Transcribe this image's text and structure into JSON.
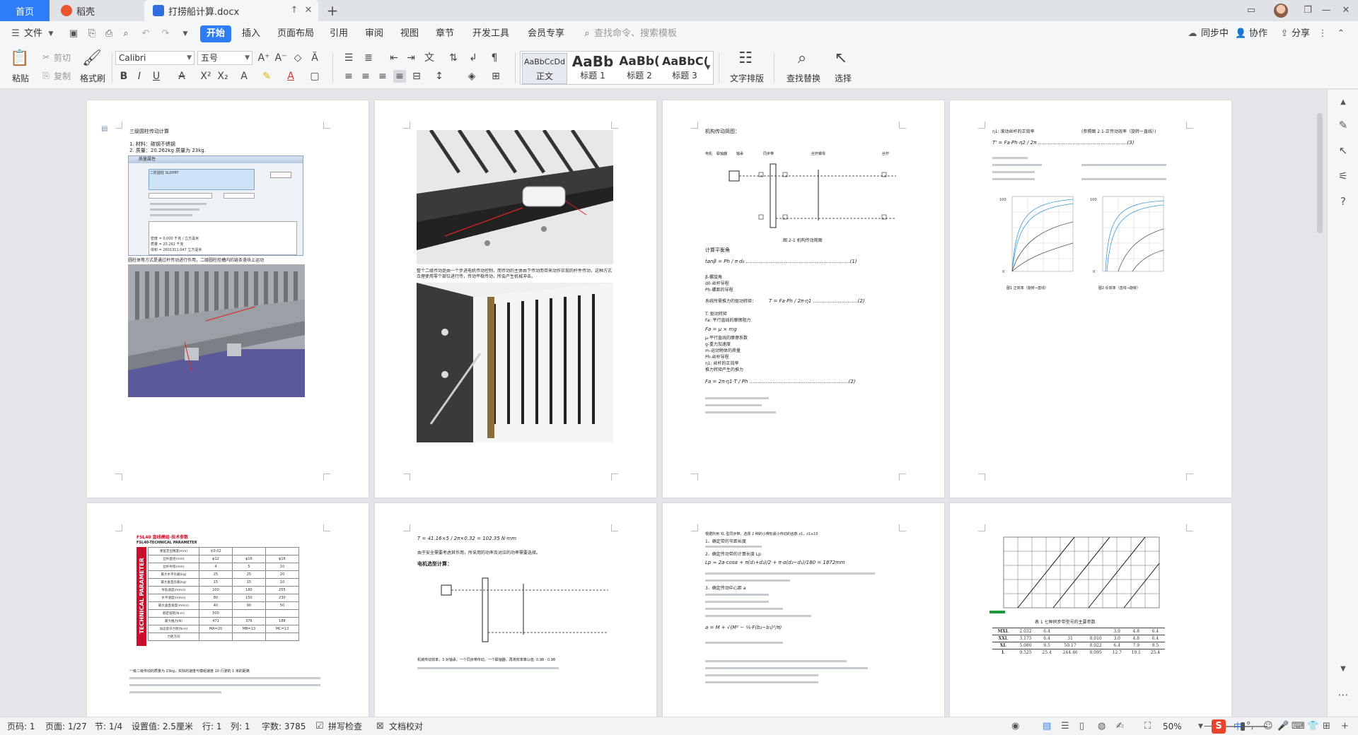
{
  "tabs": {
    "home": "首页",
    "daoke": "稻壳",
    "doc": "打捞船计算.docx"
  },
  "menu": {
    "file": "文件",
    "start": "开始",
    "insert": "插入",
    "layout": "页面布局",
    "reference": "引用",
    "review": "审阅",
    "view": "视图",
    "chapter": "章节",
    "devtools": "开发工具",
    "member": "会员专享",
    "search_placeholder": "查找命令、搜索模板",
    "sync": "同步中",
    "collab": "协作",
    "share": "分享"
  },
  "ribbon": {
    "paste": "粘贴",
    "cut": "剪切",
    "copy": "复制",
    "format_painter": "格式刷",
    "font_name": "Calibri",
    "font_size": "五号",
    "styles": [
      {
        "sample": "AaBbCcDd",
        "label": "正文"
      },
      {
        "sample": "AaBb",
        "label": "标题 1"
      },
      {
        "sample": "AaBb(",
        "label": "标题 2"
      },
      {
        "sample": "AaBbC(",
        "label": "标题 3"
      }
    ],
    "text_layout": "文字排版",
    "find_replace": "查找替换",
    "select": "选择"
  },
  "pages": {
    "p1": {
      "title": "三级圆柱传动计算",
      "line1": "1. 材料：碳钢不锈钢",
      "line2": "2. 质量：20.262kg 质量为 23kg.",
      "dlg_title": "质量属性",
      "dlg_field": "二阶圆柱 SLDPRT",
      "dlg_density": "密度 = 0.000 千克 / 立方毫米",
      "dlg_mass": "质量 = 20.262 千克",
      "dlg_volume": "体积 = 2601311.047 立方毫米",
      "caption": "圆柱体等方式是通过杆传动进行作用，二级圆柱栓槽内的链条滑块上运动"
    },
    "p2": {
      "para": "整个二级传动是由一个步进电机传动控制，而传动的主体由下传动而带来动作实现的杆件传动，这种方式合理使用零个部位进行传，传动平稳传动，所会产生机械冲击。"
    },
    "p3": {
      "heading": "机构传动简图：",
      "fig_caption": "图 2-1 机构传动简图",
      "formula_label": "计算平衡角",
      "labels": [
        "电机",
        "联轴器",
        "轴承",
        "同步带",
        "丝杆螺母",
        "丝杆"
      ],
      "def_lines": [
        "β-螺旋角",
        "d0-丝杆导程",
        "Ph-螺距的导程",
        "系统所需推力的驱动转矩：",
        "T: 驱动转矩",
        "Fa: 平行直线的摩擦阻力",
        "Fa = μ × mg",
        "μ-平行直线的摩擦系数",
        "g-重力加速度",
        "m-运动物体的质量",
        "Ph-丝杆导程",
        "η1: 丝杆的正效率",
        "推力转矩产生的推力"
      ]
    },
    "p4": {
      "line1": "η1: 滚动丝杆的正效率",
      "line2": "(参照图 2.1-正传动效率（旋转一直线）)",
      "chart1_caption": "图1 正效率（旋转→直线）",
      "chart2_caption": "图2 反效率（直线→旋转）"
    },
    "p5": {
      "title": "FSL40 直线模组-技术参数",
      "subtitle": "FSL40-TECHNICAL PARAMETER",
      "vertical_label": "TECHNICAL PARAMETER",
      "table_header": [
        "",
        "φ12",
        "φ16",
        "φ16"
      ],
      "table_rows": [
        [
          "重复定位精度(mm)",
          "±0.02",
          "",
          ""
        ],
        [
          "丝杆直径(mm)",
          "φ12",
          "φ16",
          "φ16"
        ],
        [
          "丝杆导程(mm)",
          "4",
          "5",
          "10"
        ],
        [
          "最大水平负载(kg)",
          "25",
          "25",
          "20"
        ],
        [
          "最大垂直负载(kg)",
          "15",
          "15",
          "10"
        ],
        [
          "导轨速度(mm/s)",
          "100",
          "180",
          "255"
        ],
        [
          "水平速度(mm/s)",
          "80",
          "150",
          "230"
        ],
        [
          "最大垂直速度(mm/s)",
          "40",
          "90",
          "50"
        ],
        [
          "额定扭矩(N·m)",
          "500",
          "",
          ""
        ],
        [
          "最大推力(N)",
          "471",
          "376",
          "188"
        ],
        [
          "动态容许力矩(N·m)",
          "MA=20",
          "MB=13",
          "MC=13"
        ],
        [
          "力矩方向",
          "",
          "",
          ""
        ]
      ],
      "caption": "一级二级传动的质量为 23kg，实际的速度与模组速度 10 行驶的 1 米的距离"
    },
    "p6": {
      "formula": "T = 41.16×5 / 2π×0.32 = 102.35 N·mm",
      "para": "由于安全需要考虑其作用，所采用的功率及对应的功率需要选择。",
      "heading": "电机选型计算：",
      "para2": "机械传动效率，3 对轴承，一个同步带传动，一个联轴器。再将效率乘以值: 0.98 · 0.98"
    },
    "p7": {
      "line1": "根据所用 XL 型同步带，选择 2 种的小带轮最小传动的齿数 z1，z1≥10",
      "line2": "1、确定带的节距长度",
      "line3": "2、确定传动带的计算长度 Lp",
      "line4": "3、确定传动中心距 a"
    },
    "p8": {
      "table_title": "表 1 七种同步带型号的主要参数",
      "rows": [
        [
          "MXL",
          "2.032",
          "6.4",
          "",
          "",
          "3.0",
          "4.8",
          "6.4"
        ],
        [
          "XXL",
          "3.175",
          "6.4",
          "31",
          "0.010",
          "3.0",
          "4.8",
          "6.4"
        ],
        [
          "XL",
          "5.080",
          "9.5",
          "50.17",
          "0.022",
          "6.4",
          "7.9",
          "9.5"
        ],
        [
          "L",
          "9.525",
          "25.4",
          "244.46",
          "0.095",
          "12.7",
          "19.1",
          "25.4"
        ]
      ]
    }
  },
  "status": {
    "page_num": "页码: 1",
    "page_count": "页面: 1/27",
    "section": "节: 1/4",
    "setting": "设置值: 2.5厘米",
    "row": "行: 1",
    "col": "列: 1",
    "word_count": "字数: 3785",
    "spell_check": "拼写检查",
    "doc_check": "文档校对",
    "zoom": "50%",
    "ime": "中"
  },
  "colors": {
    "accent": "#2f7df6",
    "ime": "#e8452c",
    "table_red": "#c8102e"
  }
}
